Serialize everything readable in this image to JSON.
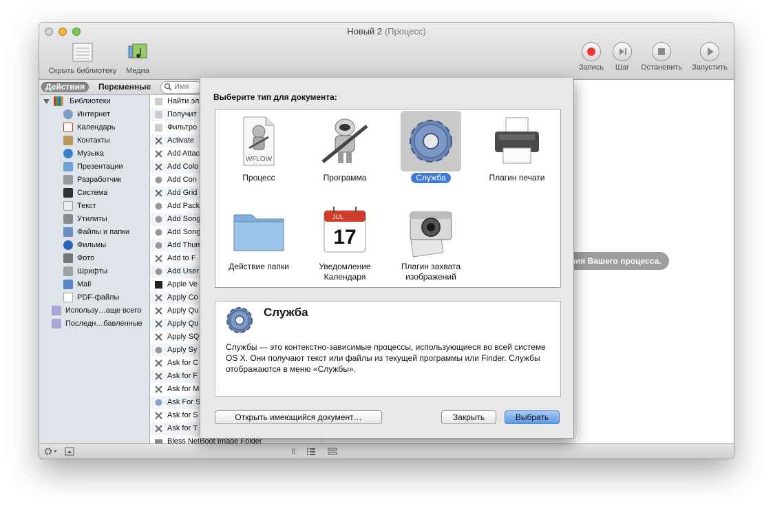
{
  "window": {
    "title": "Новый 2",
    "subtitle": "(Процесс)"
  },
  "toolbar": {
    "hide_library": "Скрыть библиотеку",
    "media": "Медиа",
    "record": "Запись",
    "step": "Шаг",
    "stop": "Остановить",
    "run": "Запустить"
  },
  "scope": {
    "actions": "Действия",
    "variables": "Переменные",
    "search_placeholder": "Имя"
  },
  "library": {
    "root": "Библиотеки",
    "items": [
      "Интернет",
      "Календарь",
      "Контакты",
      "Музыка",
      "Презентации",
      "Разработчик",
      "Система",
      "Текст",
      "Утилиты",
      "Файлы и папки",
      "Фильмы",
      "Фото",
      "Шрифты",
      "Mail",
      "PDF-файлы"
    ],
    "smart": [
      "Использу…аще всего",
      "Последн…бавленные"
    ]
  },
  "actions": {
    "items": [
      "Найти эл",
      "Получит",
      "Фильтро",
      "Activate",
      "Add Attac",
      "Add Colo",
      "Add Con",
      "Add Grid",
      "Add Pack",
      "Add Song",
      "Add Song",
      "Add Thum",
      "Add to F",
      "Add User",
      "Apple Ve",
      "Apply Co",
      "Apply Qu",
      "Apply Qu",
      "Apply SQ",
      "Apply Sy",
      "Ask for C",
      "Ask for F",
      "Ask for M",
      "Ask For S",
      "Ask for S",
      "Ask for T",
      "Bless NetBoot Image Folder"
    ]
  },
  "hint": "ания Вашего процесса.",
  "sheet": {
    "heading": "Выберите тип для документа:",
    "types": [
      {
        "label": "Процесс",
        "icon_text": "WFLOW"
      },
      {
        "label": "Программа"
      },
      {
        "label": "Служба"
      },
      {
        "label": "Плагин печати"
      },
      {
        "label": "Действие папки"
      },
      {
        "label": "Уведомление Календаря",
        "icon_month": "JUL",
        "icon_day": "17"
      },
      {
        "label": "Плагин захвата изображений"
      }
    ],
    "selected": "Служба",
    "desc_title": "Служба",
    "desc_text": "Службы — это контекстно-зависимые процессы, использующиеся во всей системе OS X. Они получают текст или файлы из текущей программы или Finder. Службы отображаются в меню «Службы».",
    "open_existing": "Открыть имеющийся документ…",
    "close": "Закрыть",
    "choose": "Выбрать"
  }
}
